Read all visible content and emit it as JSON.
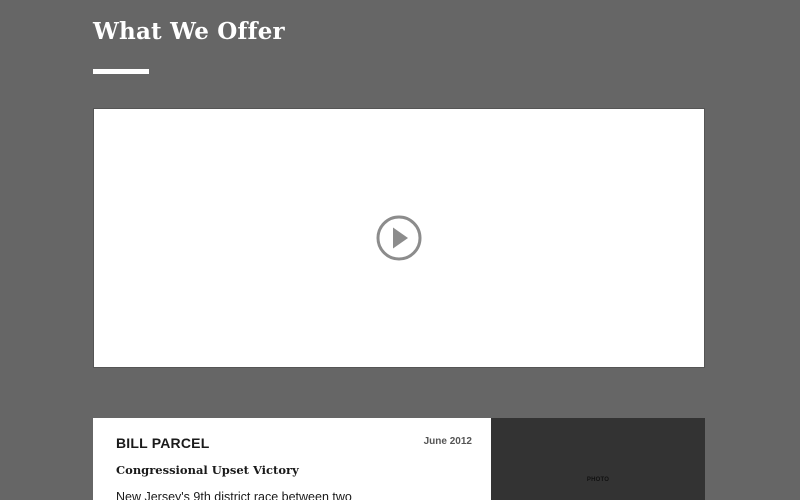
{
  "section": {
    "title": "What We Offer"
  },
  "video": {
    "play_icon": "play-circle-icon"
  },
  "story": {
    "name": "BILL PARCEL",
    "date": "June 2012",
    "headline": "Congressional Upset Victory",
    "body": "New Jersey's 9th district race between two"
  },
  "photo": {
    "label": "PHOTO"
  },
  "colors": {
    "background": "#666666",
    "card": "#ffffff",
    "photo_placeholder": "#333333",
    "play_icon": "#8c8c8c"
  }
}
